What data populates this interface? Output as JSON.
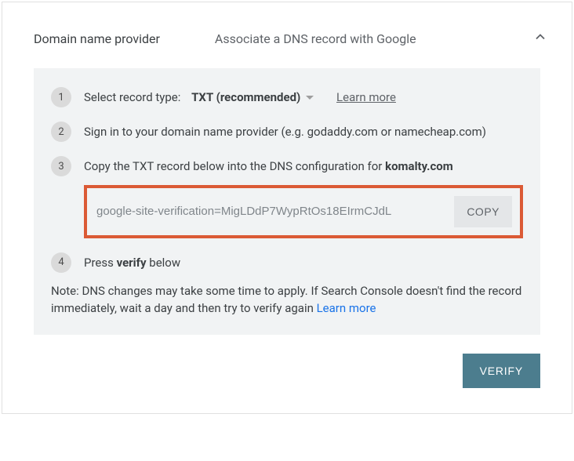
{
  "header": {
    "title": "Domain name provider",
    "subtitle": "Associate a DNS record with Google"
  },
  "steps": {
    "s1": {
      "num": "1",
      "label": "Select record type:",
      "record_type": "TXT (recommended)",
      "learn_more": "Learn more"
    },
    "s2": {
      "num": "2",
      "text": "Sign in to your domain name provider (e.g. godaddy.com or namecheap.com)"
    },
    "s3": {
      "num": "3",
      "pre": "Copy the TXT record below into the DNS configuration for ",
      "domain": "komalty.com",
      "txt_value": "google-site-verification=MigLDdP7WypRtOs18EIrmCJdL",
      "copy_label": "COPY"
    },
    "s4": {
      "num": "4",
      "pre": "Press ",
      "bold": "verify",
      "post": " below"
    }
  },
  "note": {
    "text": "Note: DNS changes may take some time to apply. If Search Console doesn't find the record immediately, wait a day and then try to verify again ",
    "learn_more": "Learn more"
  },
  "footer": {
    "verify_label": "VERIFY"
  }
}
